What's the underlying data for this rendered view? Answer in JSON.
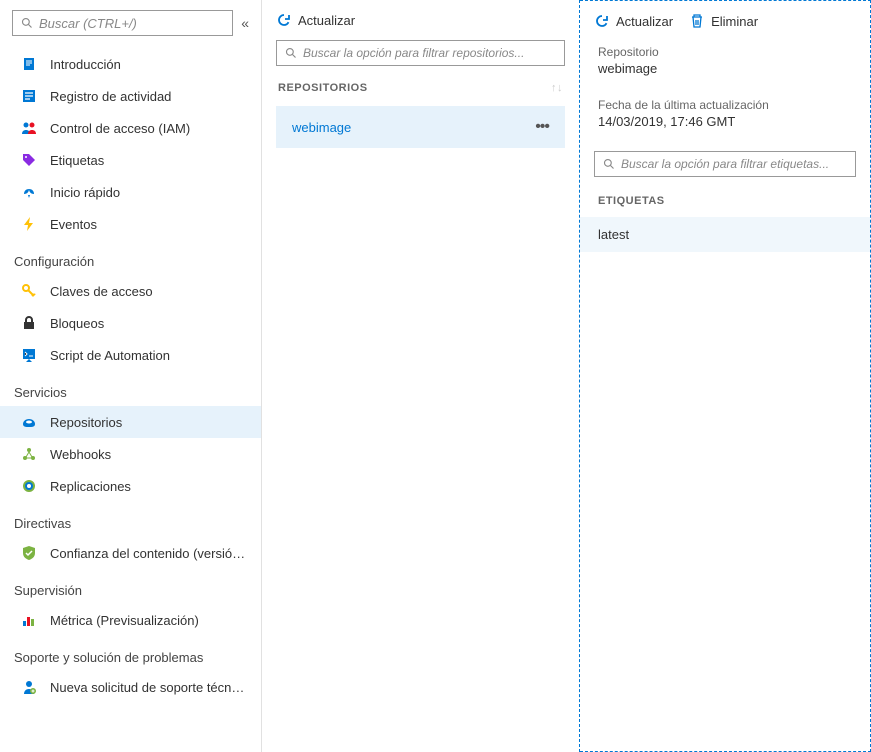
{
  "sidebar": {
    "search_placeholder": "Buscar (CTRL+/)",
    "groups": [
      {
        "title": null,
        "items": [
          {
            "icon": "info",
            "label": "Introducción"
          },
          {
            "icon": "activity",
            "label": "Registro de actividad"
          },
          {
            "icon": "iam",
            "label": "Control de acceso (IAM)"
          },
          {
            "icon": "tag",
            "label": "Etiquetas"
          },
          {
            "icon": "quickstart",
            "label": "Inicio rápido"
          },
          {
            "icon": "events",
            "label": "Eventos"
          }
        ]
      },
      {
        "title": "Configuración",
        "items": [
          {
            "icon": "key",
            "label": "Claves de acceso"
          },
          {
            "icon": "lock",
            "label": "Bloqueos"
          },
          {
            "icon": "automation",
            "label": "Script de Automation"
          }
        ]
      },
      {
        "title": "Servicios",
        "items": [
          {
            "icon": "repositories",
            "label": "Repositorios",
            "selected": true
          },
          {
            "icon": "webhooks",
            "label": "Webhooks"
          },
          {
            "icon": "replications",
            "label": "Replicaciones"
          }
        ]
      },
      {
        "title": "Directivas",
        "items": [
          {
            "icon": "shield",
            "label": "Confianza del contenido (versión..."
          }
        ]
      },
      {
        "title": "Supervisión",
        "items": [
          {
            "icon": "metrics",
            "label": "Métrica (Previsualización)"
          }
        ]
      },
      {
        "title": "Soporte y solución de problemas",
        "items": [
          {
            "icon": "support",
            "label": "Nueva solicitud de soporte técnico"
          }
        ]
      }
    ]
  },
  "middle": {
    "refresh_label": "Actualizar",
    "filter_placeholder": "Buscar la opción para filtrar repositorios...",
    "header_label": "REPOSITORIOS",
    "items": [
      {
        "name": "webimage"
      }
    ]
  },
  "right": {
    "refresh_label": "Actualizar",
    "delete_label": "Eliminar",
    "repo_label": "Repositorio",
    "repo_value": "webimage",
    "updated_label": "Fecha de la última actualización",
    "updated_value": "14/03/2019, 17:46 GMT",
    "filter_placeholder": "Buscar la opción para filtrar etiquetas...",
    "tags_header": "ETIQUETAS",
    "tags": [
      {
        "name": "latest"
      }
    ]
  }
}
